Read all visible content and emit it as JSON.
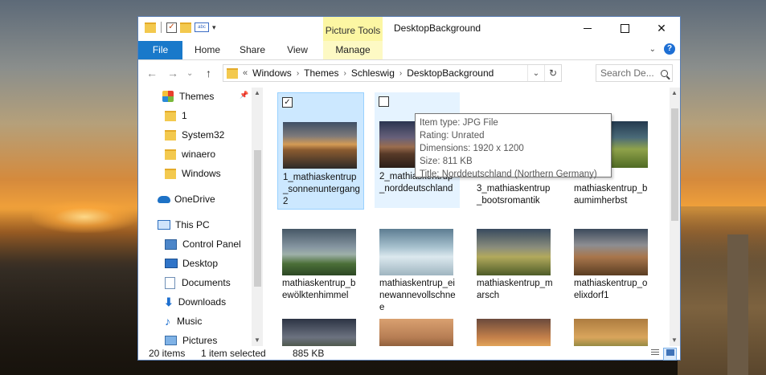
{
  "window": {
    "title": "DesktopBackground",
    "contextual_tab_group": "Picture Tools",
    "minimize_glyph": "",
    "maximize_glyph": "",
    "close_glyph": "✕"
  },
  "ribbon": {
    "tabs": [
      {
        "label": "File"
      },
      {
        "label": "Home"
      },
      {
        "label": "Share"
      },
      {
        "label": "View"
      },
      {
        "label": "Manage"
      }
    ],
    "collapse_glyph": "⌄",
    "help_glyph": "?"
  },
  "nav_buttons": {
    "back": "←",
    "forward": "→",
    "recent": "⌄",
    "up": "↑"
  },
  "address": {
    "overflow": "«",
    "crumbs": [
      "Windows",
      "Themes",
      "Schleswig",
      "DesktopBackground"
    ],
    "dropdown_glyph": "⌄",
    "refresh_glyph": "↻"
  },
  "search": {
    "placeholder": "Search De..."
  },
  "navpane": {
    "items": [
      {
        "label": "Themes"
      },
      {
        "label": "1"
      },
      {
        "label": "System32"
      },
      {
        "label": "winaero"
      },
      {
        "label": "Windows"
      },
      {
        "label": "OneDrive"
      },
      {
        "label": "This PC"
      },
      {
        "label": "Control Panel"
      },
      {
        "label": "Desktop"
      },
      {
        "label": "Documents"
      },
      {
        "label": "Downloads"
      },
      {
        "label": "Music"
      },
      {
        "label": "Pictures"
      }
    ],
    "pin_glyph": "📌"
  },
  "files": [
    {
      "label": "1_mathiaskentrup_sonnenuntergang2",
      "checked": "✓"
    },
    {
      "label": "2_mathiaskentrup_norddeutschland",
      "checked": ""
    },
    {
      "label": "3_mathiaskentrup_bootsromantik"
    },
    {
      "label": "mathiaskentrup_baumimherbst"
    },
    {
      "label": "mathiaskentrup_bewölktenhimmel"
    },
    {
      "label": "mathiaskentrup_einewannevollschnee"
    },
    {
      "label": "mathiaskentrup_marsch"
    },
    {
      "label": "mathiaskentrup_oelixdorf1"
    }
  ],
  "tooltip": {
    "line1": "Item type: JPG File",
    "line2": "Rating: Unrated",
    "line3": "Dimensions: 1920 x 1200",
    "line4": "Size: 811 KB",
    "line5": "Title: Norddeutschland (Northern Germany)"
  },
  "status": {
    "items": "20 items",
    "selection": "1 item selected",
    "size": "885 KB"
  },
  "colors": {
    "file_tab": "#1979ca",
    "selection": "#cce8ff",
    "picture_tools": "#fcf6a3"
  }
}
